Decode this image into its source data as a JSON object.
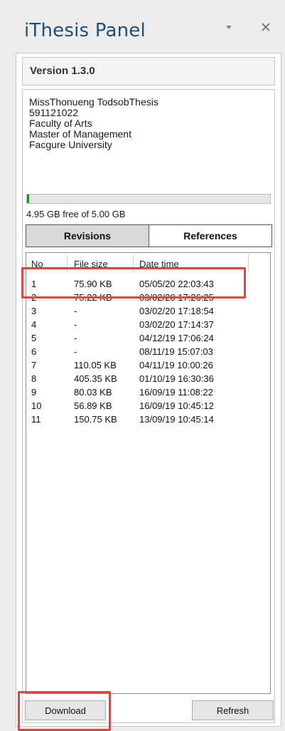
{
  "panel": {
    "title": "iThesis Panel"
  },
  "version": "Version 1.3.0",
  "user_info": {
    "lines": [
      "MissThonueng TodsobThesis",
      "591121022",
      "Faculty of Arts",
      "Master of Management",
      "Facgure University"
    ]
  },
  "storage": {
    "text": "4.95 GB free of 5.00 GB",
    "used_fraction": 0.01
  },
  "tabs": [
    {
      "label": "Revisions",
      "active": true
    },
    {
      "label": "References",
      "active": false
    }
  ],
  "revisions": {
    "columns": [
      "No",
      "File size",
      "Date time"
    ],
    "rows": [
      {
        "no": "1",
        "size": "75.90 KB",
        "date": "05/05/20 22:03:43"
      },
      {
        "no": "2",
        "size": "75.22 KB",
        "date": "03/02/20 17:26:25"
      },
      {
        "no": "3",
        "size": "-",
        "date": "03/02/20 17:18:54"
      },
      {
        "no": "4",
        "size": "-",
        "date": "03/02/20 17:14:37"
      },
      {
        "no": "5",
        "size": "-",
        "date": "04/12/19 17:06:24"
      },
      {
        "no": "6",
        "size": "-",
        "date": "08/11/19 15:07:03"
      },
      {
        "no": "7",
        "size": "110.05 KB",
        "date": "04/11/19 10:00:26"
      },
      {
        "no": "8",
        "size": "405.35 KB",
        "date": "01/10/19 16:30:36"
      },
      {
        "no": "9",
        "size": "80.03 KB",
        "date": "16/09/19 11:08:22"
      },
      {
        "no": "10",
        "size": "56.89 KB",
        "date": "16/09/19 10:45:12"
      },
      {
        "no": "11",
        "size": "150.75 KB",
        "date": "13/09/19 10:45:14"
      }
    ]
  },
  "buttons": {
    "download": "Download",
    "refresh": "Refresh"
  },
  "colors": {
    "title": "#1f4e79",
    "highlight": "#e0453c",
    "storage_fill": "#2a8a2a"
  }
}
